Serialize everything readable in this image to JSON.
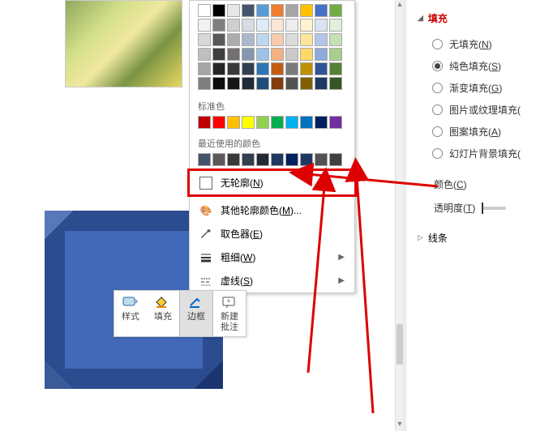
{
  "themeColors": [
    [
      "#ffffff",
      "#000000",
      "#e7e6e6",
      "#44546a",
      "#5b9bd5",
      "#ed7d31",
      "#a5a5a5",
      "#ffc000",
      "#4472c4",
      "#70ad47"
    ],
    [
      "#f2f2f2",
      "#7f7f7f",
      "#d0cece",
      "#d6dce4",
      "#deebf6",
      "#fbe5d5",
      "#ededed",
      "#fff2cc",
      "#dae3f3",
      "#e2efd9"
    ],
    [
      "#d8d8d8",
      "#595959",
      "#aeabab",
      "#adb9ca",
      "#bdd7ee",
      "#f7cbac",
      "#dbdbdb",
      "#fee599",
      "#b4c6e7",
      "#c5e0b3"
    ],
    [
      "#bfbfbf",
      "#3f3f3f",
      "#757070",
      "#8496b0",
      "#9cc3e5",
      "#f4b183",
      "#c9c9c9",
      "#ffd965",
      "#8eaadb",
      "#a8d08d"
    ],
    [
      "#a5a5a5",
      "#262626",
      "#3a3838",
      "#323f4f",
      "#2e75b5",
      "#c55a11",
      "#7b7b7b",
      "#bf9000",
      "#2f5496",
      "#538135"
    ],
    [
      "#7f7f7f",
      "#0c0c0c",
      "#171616",
      "#222a35",
      "#1e4e79",
      "#833c0b",
      "#525252",
      "#7f6000",
      "#1f3864",
      "#375623"
    ]
  ],
  "standardColors": [
    "#c00000",
    "#ff0000",
    "#ffc000",
    "#ffff00",
    "#92d050",
    "#00b050",
    "#00b0f0",
    "#0070c0",
    "#002060",
    "#7030a0"
  ],
  "recentColors": [
    "#44546a",
    "#595959",
    "#3a3838",
    "#323f4f",
    "#222a35",
    "#1f3864",
    "#002060",
    "#203864",
    "#525252",
    "#404040"
  ],
  "labels": {
    "standard": "标准色",
    "recent": "最近使用的颜色",
    "noOutline": "无轮廓(N)",
    "moreColors": "其他轮廓颜色(M)...",
    "eyedropper": "取色器(E)",
    "weight": "粗细(W)",
    "dashes": "虚线(S)"
  },
  "miniToolbar": {
    "style": "样式",
    "fill": "填充",
    "border": "边框",
    "comment": "新建\n批注"
  },
  "panel": {
    "fillTitle": "填充",
    "noFill": "无填充(N)",
    "solidFill": "纯色填充(S)",
    "gradientFill": "渐变填充(G)",
    "pictureFill": "图片或纹理填充(P)",
    "patternFill": "图案填充(A)",
    "slideBgFill": "幻灯片背景填充(B)",
    "color": "颜色(C)",
    "transparency": "透明度(T)",
    "line": "线条"
  }
}
